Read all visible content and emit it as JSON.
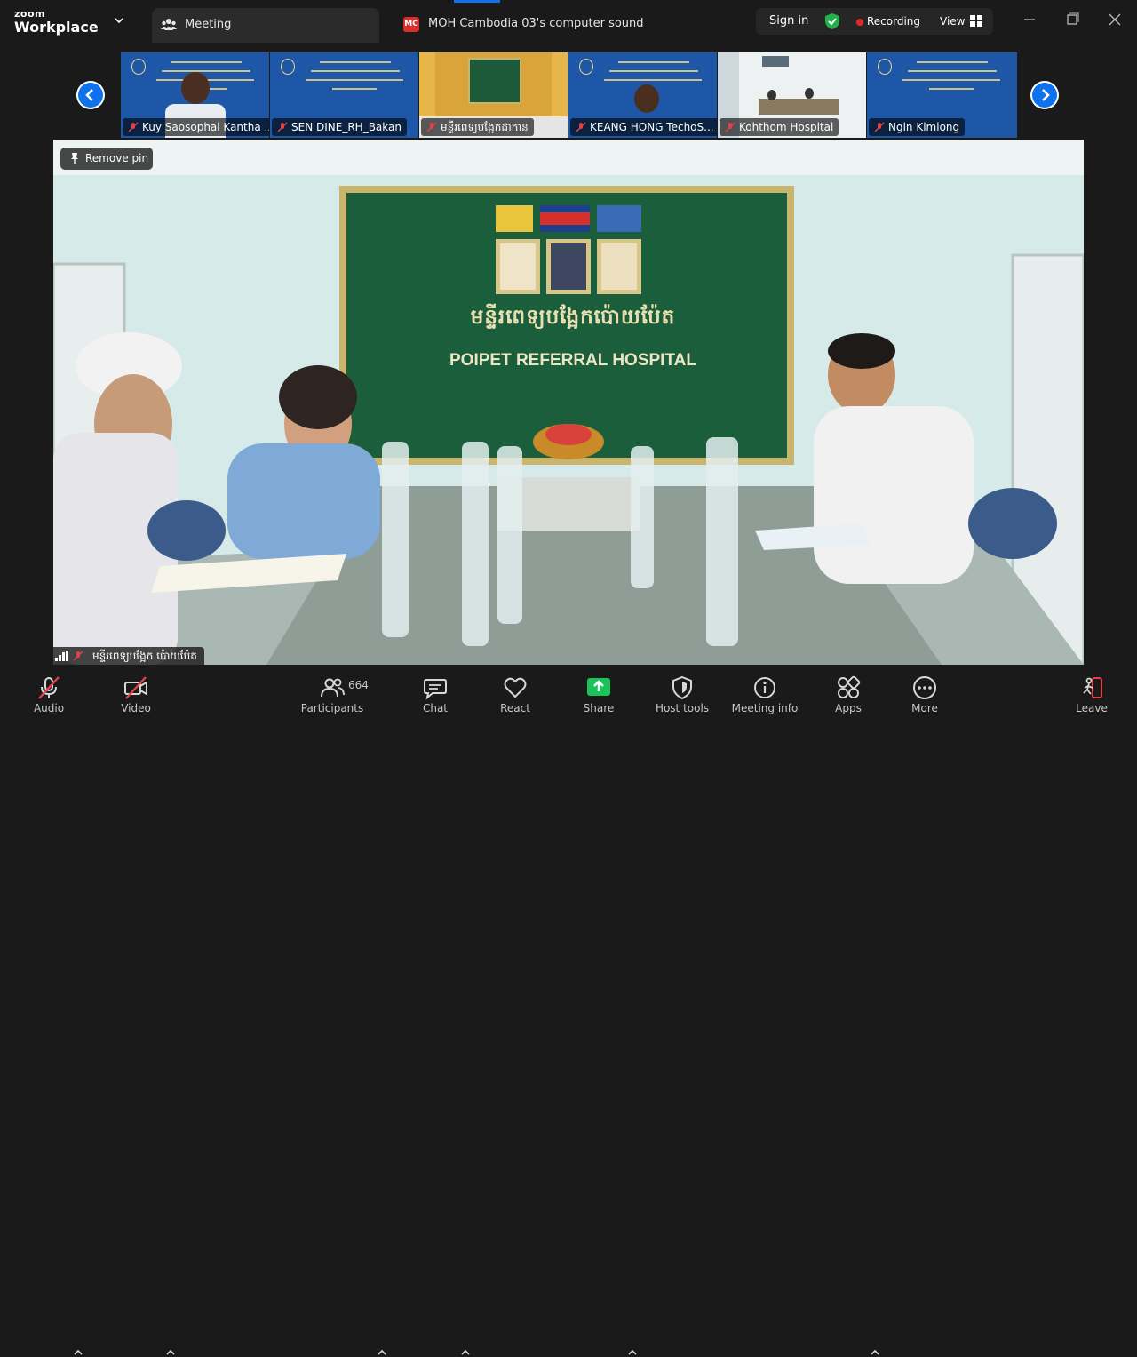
{
  "app": {
    "brand_small": "zoom",
    "brand_big": "Workplace"
  },
  "tabs": {
    "meeting_label": "Meeting",
    "sound_badge": "MC",
    "sound_label": "MOH Cambodia 03's computer sound"
  },
  "header": {
    "sign_in": "Sign in",
    "recording": "Recording",
    "view": "View"
  },
  "thumbnails": [
    {
      "name": "Kuy Saosophal Kantha ..."
    },
    {
      "name": "SEN DINE_RH_Bakan"
    },
    {
      "name": "មន្ទីរពេទ្យបង្អែកដាកាន"
    },
    {
      "name": "KEANG HONG TechoS..."
    },
    {
      "name": "Kohthom Hospital"
    },
    {
      "name": "Ngin Kimlong"
    }
  ],
  "main": {
    "remove_pin": "Remove pin",
    "board_title_km": "មន្ទីរពេទ្យបង្អែកប៉ោយប៉ែត",
    "board_title_en": "POIPET REFERRAL HOSPITAL",
    "speaker_name": "មន្ទីរពេទ្យបង្អែក ប៉ោយប៉ែត"
  },
  "toolbar": {
    "audio": "Audio",
    "video": "Video",
    "participants": "Participants",
    "participants_count": "664",
    "chat": "Chat",
    "react": "React",
    "share": "Share",
    "host_tools": "Host tools",
    "meeting_info": "Meeting info",
    "apps": "Apps",
    "more": "More",
    "leave": "Leave"
  },
  "colors": {
    "accent": "#0e72ed",
    "share_green": "#19c35a",
    "recording_red": "#e02828",
    "mute_red": "#e0424a",
    "banner_blue": "#1f57a8",
    "board_green": "#1a5e3c"
  }
}
